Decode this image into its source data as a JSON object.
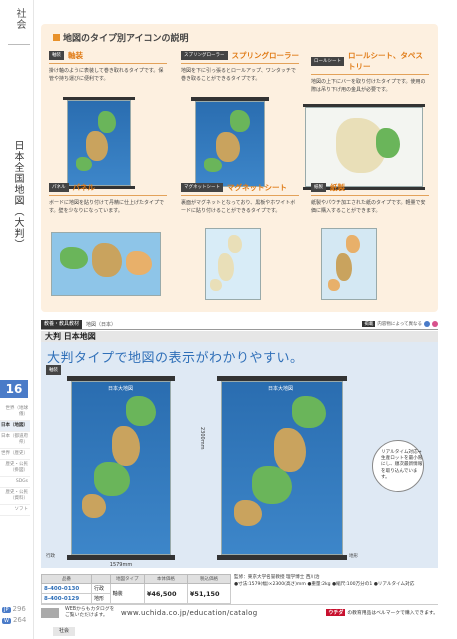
{
  "rail": {
    "subject": "社会",
    "section_title": "日本全国地図（大判）",
    "page_number": "16",
    "nav_items": [
      "世界（地球儀）",
      "日本（地図）",
      "日本（都道府県）",
      "世界（歴史）",
      "歴史・公民（掛図）",
      "SDGs",
      "歴史・公民（資料）",
      "ソフト"
    ],
    "active_nav": 1,
    "page_refs": [
      {
        "badge": "JP",
        "page": "296"
      },
      {
        "badge": "W",
        "page": "264"
      }
    ]
  },
  "icon_section": {
    "title": "地図のタイプ別アイコンの説明",
    "types": [
      {
        "badge": "軸装",
        "name": "軸装",
        "desc": "掛け軸のように表装して巻き取れるタイプです。保管や持ち運びに便利です。"
      },
      {
        "badge": "スプリングローラー",
        "name": "スプリングローラー",
        "desc": "地図を下に引っ張るとロールアップ、ワンタッチで巻き取ることができるタイプです。"
      },
      {
        "badge": "ロールシート",
        "name": "ロールシート、タペストリー",
        "desc": "地図の上下にバーを取り付けたタイプです。使用の際は吊り下げ用の金具が必要です。"
      },
      {
        "badge": "パネル",
        "name": "パネル",
        "desc": "ボードに地図を貼り付けて丹精に仕上げたタイプです。壁を少なりになっています。"
      },
      {
        "badge": "マグネットシート",
        "name": "マグネットシート",
        "desc": "裏面がマグネットとなっており、黒板やホワイトボードに貼り付けることができるタイプです。"
      },
      {
        "badge": "紙製",
        "name": "紙製",
        "desc": "紙製やパウチ加工された紙のタイプです。軽量で安価に購入することができます。"
      }
    ]
  },
  "product": {
    "category": "教養・教具教材",
    "subcategory": "地図（日本）",
    "note_badge": "掲載",
    "note": "内容物によって異なる",
    "title": "大判 日本地図",
    "headline": "大判タイプで地図の表示がわかりやすい。",
    "main_badge": "軸装",
    "map_title_left": "日本大地図",
    "map_title_right": "日本大地図",
    "callout": "リアルタイム対応⇒生産ロットを最小限にし、順次最新情報を取り込んでいます。",
    "width_label": "1579mm",
    "height_label": "2300mm",
    "tag_left": "行政",
    "tag_right": "地形",
    "spec_headers": [
      "品番",
      "",
      "地図タイプ",
      "本体価格",
      "税込価格"
    ],
    "spec_rows": [
      {
        "code": "8-400-0130",
        "kind": "行政",
        "type": "",
        "price": "",
        "tax_price": ""
      },
      {
        "code": "8-400-0129",
        "kind": "地形",
        "type": "軸装",
        "price": "¥46,500",
        "tax_price": "¥51,150"
      }
    ],
    "spec_text_1": "監修：東京大学名誉教授 理学博士 西川治",
    "spec_text_2": "●寸法:1579(幅)×2300(高さ)mm ●重量:2kg ●縮尺:100万分の1 ●リアルタイム対応"
  },
  "footer": {
    "text": "WEBからもカタログをご覧いただけます。",
    "url": "www.uchida.co.jp/education/catalog",
    "logo": "ウチダ",
    "mark_text": "の教育用品はベルマークで購入できます。",
    "bottom_tab": "社会"
  },
  "colors": {
    "accent_orange": "#e07b16",
    "accent_blue": "#2f6fb8",
    "box_bg": "#fdf0e0",
    "main_bg": "#dfe9f4"
  }
}
